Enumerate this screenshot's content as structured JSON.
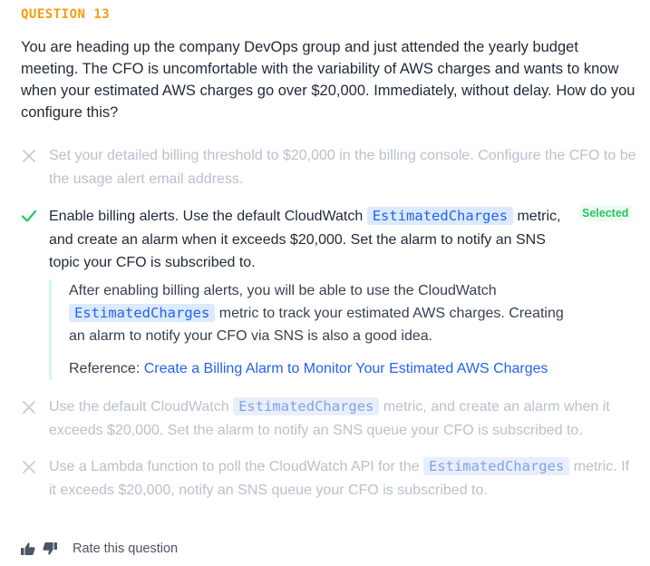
{
  "question": {
    "label": "QUESTION 13",
    "text": "You are heading up the company DevOps group and just attended the yearly budget meeting. The CFO is uncomfortable with the variability of AWS charges and wants to know when your estimated AWS charges go over $20,000. Immediately, without delay. How do you configure this?"
  },
  "options": [
    {
      "status": "incorrect",
      "text": "Set your detailed billing threshold to $20,000 in the billing console. Configure the CFO to be the usage alert email address."
    },
    {
      "status": "correct",
      "before": "Enable billing alerts. Use the default CloudWatch ",
      "code": "EstimatedCharges",
      "after": " metric, and create an alarm when it exceeds $20,000. Set the alarm to notify an SNS topic your CFO is subscribed to.",
      "badge": "Selected"
    },
    {
      "status": "incorrect",
      "before": "Use the default CloudWatch ",
      "code": "EstimatedCharges",
      "after": " metric, and create an alarm when it exceeds $20,000. Set the alarm to notify an SNS queue your CFO is subscribed to."
    },
    {
      "status": "incorrect",
      "before": "Use a Lambda function to poll the CloudWatch API for the ",
      "code": "EstimatedCharges",
      "after": " metric. If it exceeds $20,000, notify an SNS queue your CFO is subscribed to."
    }
  ],
  "explanation": {
    "before": "After enabling billing alerts, you will be able to use the CloudWatch ",
    "code": "EstimatedCharges",
    "after": " metric to track your estimated AWS charges. Creating an alarm to notify your CFO via SNS is also a good idea.",
    "reference_label": "Reference: ",
    "reference_link": "Create a Billing Alarm to Monitor Your Estimated AWS Charges"
  },
  "footer": {
    "thumbs_up_icon": "thumbs-up-icon",
    "thumbs_down_icon": "thumbs-down-icon",
    "rate_label": "Rate this question"
  },
  "colors": {
    "accent_orange": "#f59e0b",
    "correct_green": "#22c55e",
    "code_blue": "#2563eb",
    "code_bg": "#dbeafe",
    "muted_text": "#b9c1cc"
  }
}
